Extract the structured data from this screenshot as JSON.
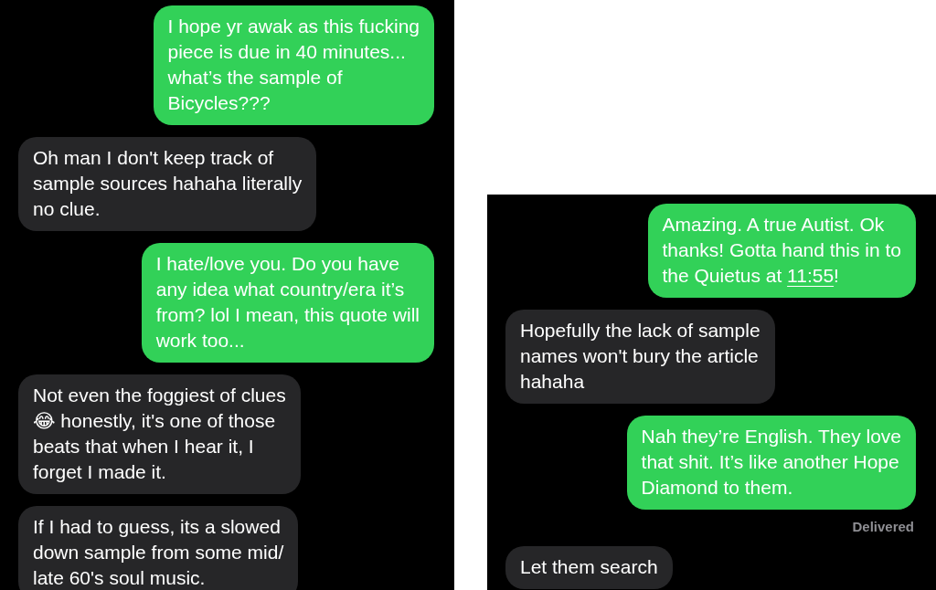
{
  "screenshots": [
    {
      "messages": [
        {
          "kind": "sent",
          "segments": [
            {
              "kind": "plain",
              "text": "I hope yr awak as this fucking\npiece is due in 40 minutes...\nwhat’s the sample of\nBicycles???"
            }
          ]
        },
        {
          "kind": "received",
          "segments": [
            {
              "kind": "plain",
              "text": "Oh man I don't keep track of\nsample sources hahaha literally\nno clue."
            }
          ]
        },
        {
          "kind": "sent",
          "segments": [
            {
              "kind": "plain",
              "text": "I hate/love you. Do you have\nany idea what country/era it’s\nfrom? lol I mean, this quote will\nwork too..."
            }
          ]
        },
        {
          "kind": "received",
          "segments": [
            {
              "kind": "plain",
              "text": "Not even the foggiest of clues\n😂 honestly, it's one of those\nbeats that when I hear it, I\nforget I made it."
            }
          ]
        },
        {
          "kind": "received",
          "segments": [
            {
              "kind": "plain",
              "text": "If I had to guess, its a slowed\ndown sample from some mid/\nlate 60's soul music."
            }
          ]
        }
      ]
    },
    {
      "messages": [
        {
          "kind": "sent",
          "segments": [
            {
              "kind": "plain",
              "text": "Amazing. A true Autist. Ok\nthanks! Gotta hand this in to\nthe Quietus at "
            },
            {
              "kind": "link",
              "text": "11:55"
            },
            {
              "kind": "plain",
              "text": "!"
            }
          ]
        },
        {
          "kind": "received",
          "segments": [
            {
              "kind": "plain",
              "text": "Hopefully the lack of sample\nnames won't bury the article\nhahaha"
            }
          ]
        },
        {
          "kind": "sent",
          "segments": [
            {
              "kind": "plain",
              "text": "Nah they’re English. They love\nthat shit. It’s like another Hope\nDiamond to them."
            }
          ],
          "status": "Delivered"
        },
        {
          "kind": "received",
          "segments": [
            {
              "kind": "plain",
              "text": "Let them search"
            }
          ]
        }
      ]
    }
  ]
}
